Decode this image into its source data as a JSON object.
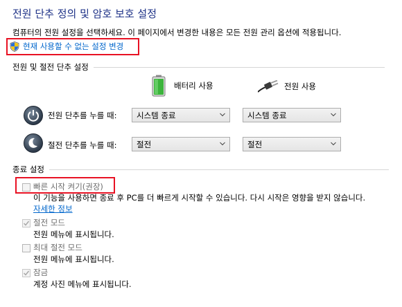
{
  "page": {
    "title": "전원 단추 정의 및 암호 보호 설정",
    "description": "컴퓨터의 전원 설정을 선택하세요. 이 페이지에서 변경한 내용은 모든 전원 관리 옵션에 적용됩니다.",
    "change_unavailable_link": "현재 사용할 수 없는 설정 변경"
  },
  "power_buttons": {
    "section_title": "전원 및 절전 단추 설정",
    "columns": {
      "battery": "배터리 사용",
      "plugged_in": "전원 사용"
    },
    "rows": [
      {
        "label": "전원 단추를 누를 때:",
        "battery_value": "시스템 종료",
        "plugged_value": "시스템 종료"
      },
      {
        "label": "절전 단추를 누를 때:",
        "battery_value": "절전",
        "plugged_value": "절전"
      }
    ]
  },
  "shutdown": {
    "section_title": "종료 설정",
    "options": [
      {
        "label": "빠른 시작 켜기(권장)",
        "description": "이 기능을 사용하면 종료 후 PC를 더 빠르게 시작할 수 있습니다. 다시 시작은 영향을 받지 않습니다.",
        "link": "자세한 정보",
        "checked": false
      },
      {
        "label": "절전 모드",
        "description": "전원 메뉴에 표시됩니다.",
        "checked": true
      },
      {
        "label": "최대 절전 모드",
        "description": "전원 메뉴에 표시됩니다.",
        "checked": false
      },
      {
        "label": "잠금",
        "description": "계정 사진 메뉴에 표시됩니다.",
        "checked": true
      }
    ]
  },
  "colors": {
    "title": "#1e3287",
    "link": "#0066cc",
    "highlight": "#e81123",
    "battery": "#3cb43c"
  }
}
